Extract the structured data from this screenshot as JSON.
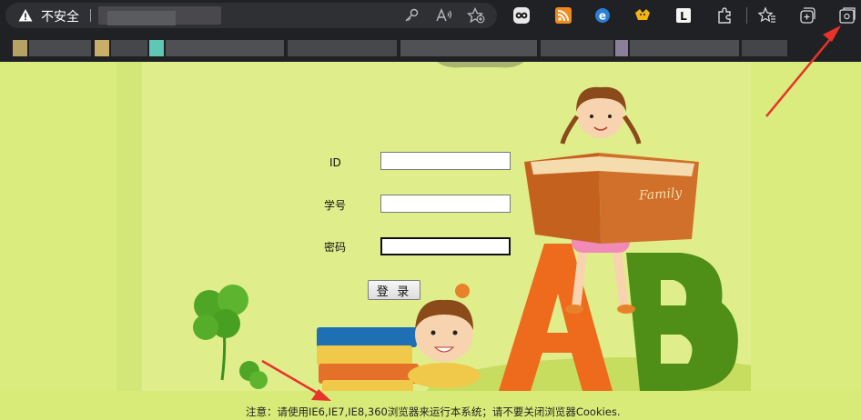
{
  "browser": {
    "security_label": "不安全",
    "toolbar_icons": [
      "key-icon",
      "read-aloud-icon",
      "favorite-add-icon"
    ],
    "extensions": [
      "ext-owl-icon",
      "ext-rss-icon",
      "ext-e-icon",
      "ext-fox-icon",
      "ext-l-icon",
      "extensions-puzzle-icon",
      "favorites-icon",
      "collections-icon",
      "screenshot-icon"
    ],
    "ext_l_text": "L"
  },
  "form": {
    "id_label": "ID",
    "student_no_label": "学号",
    "password_label": "密码",
    "login_button": "登 录",
    "id_value": "",
    "student_no_value": "",
    "password_value": ""
  },
  "illustration": {
    "book_title": "Family",
    "letter_a": "A",
    "letter_b": "B"
  },
  "footer": {
    "notice": "注意：请使用IE6,IE7,IE8,360浏览器来运行本系统；请不要关闭浏览器Cookies."
  },
  "colors": {
    "page_bg": "#d9ec7d",
    "chrome_bg": "#202124",
    "arrow_red": "#e8332a"
  }
}
